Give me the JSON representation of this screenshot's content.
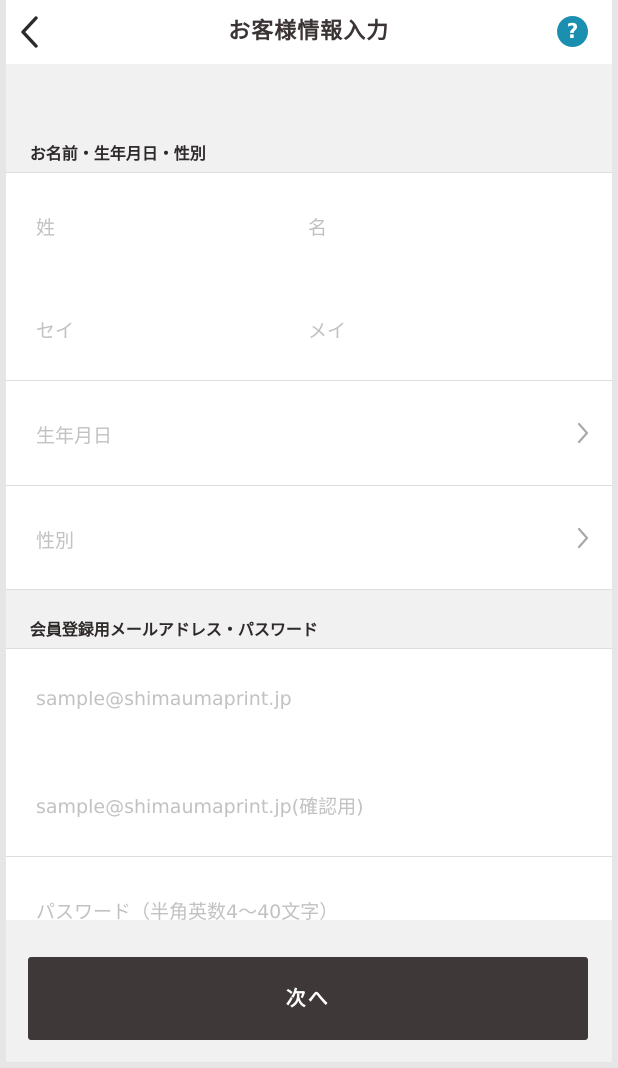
{
  "header": {
    "title": "お客様情報入力",
    "help_label": "?"
  },
  "sections": {
    "personal": {
      "label": "お名前・生年月日・性別",
      "last_name_placeholder": "姓",
      "first_name_placeholder": "名",
      "last_kana_placeholder": "セイ",
      "first_kana_placeholder": "メイ",
      "birthday_placeholder": "生年月日",
      "gender_placeholder": "性別"
    },
    "account": {
      "label": "会員登録用メールアドレス・パスワード",
      "email_placeholder": "sample@shimaumaprint.jp",
      "email_confirm_placeholder": "sample@shimaumaprint.jp(確認用)",
      "password_placeholder": "パスワード（半角英数4〜40文字）"
    }
  },
  "footer": {
    "next_label": "次へ"
  },
  "colors": {
    "accent": "#1a8fb0",
    "button_bg": "#3f3838",
    "placeholder": "#c2c2c2"
  },
  "icons": {
    "back": "chevron-left-icon",
    "help": "question-icon",
    "row_arrow": "chevron-right-icon"
  }
}
